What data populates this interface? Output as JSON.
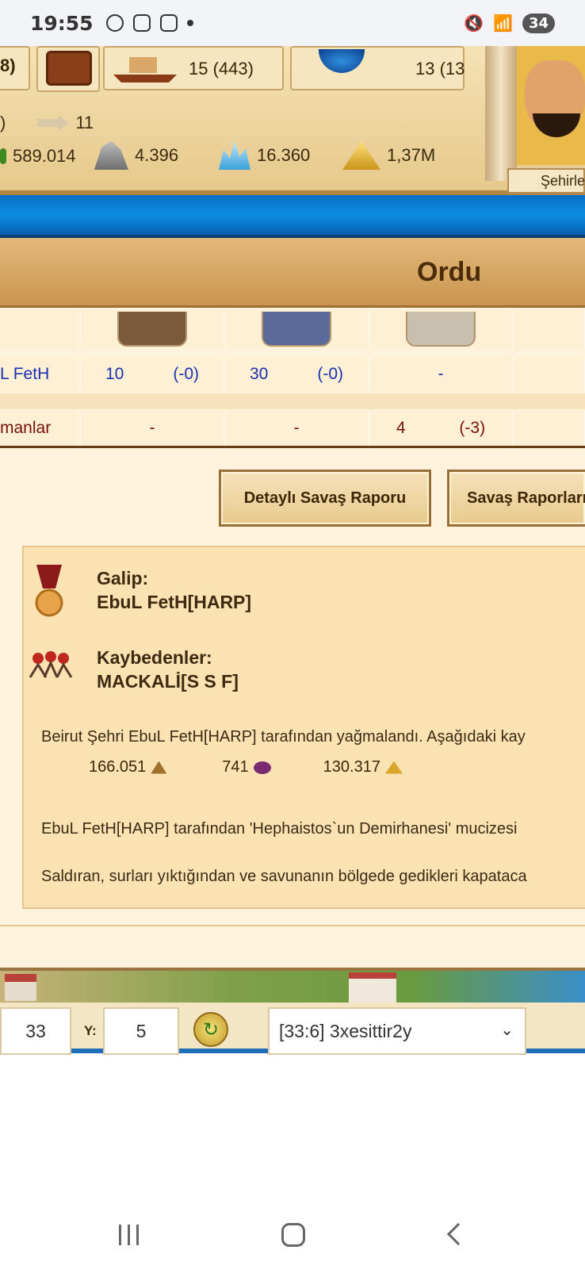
{
  "status": {
    "time": "19:55",
    "battery": "34"
  },
  "header": {
    "ships": "15 (443)",
    "globe": "13 (13",
    "left_partial": "8)",
    "arrow_count": "11",
    "paren": ")",
    "resources": [
      "589.014",
      "4.396",
      "16.360",
      "1,37M"
    ],
    "city_label": "Şehirle"
  },
  "page": {
    "title": "Ordu"
  },
  "troops": {
    "attacker_name": "L FetH",
    "attacker_values": [
      "10",
      "(-0)",
      "30",
      "(-0)",
      "-"
    ],
    "defender_name": "manlar",
    "defender_values": [
      "-",
      "-",
      "4",
      "(-3)"
    ]
  },
  "buttons": {
    "detail": "Detaylı Savaş Raporu",
    "reports": "Savaş Raporları"
  },
  "report": {
    "winner_label": "Galip:",
    "winner": "EbuL FetH[HARP]",
    "losers_label": "Kaybedenler:",
    "losers": "MACKALİ[S S F]",
    "plunder_text": "Beirut Şehri EbuL FetH[HARP] tarafından yağmalandı. Aşağıdaki kay",
    "loot": [
      "166.051",
      "741",
      "130.317"
    ],
    "wonder_text": "EbuL FetH[HARP] tarafından 'Hephaistos`un Demirhanesi' mucizesi",
    "walls_text": "Saldıran, surları yıktığından ve savunanın bölgede gedikleri kapataca"
  },
  "coords": {
    "x": "33",
    "y_label": "Y:",
    "y": "5",
    "city": "[33:6] 3xesittir2y"
  }
}
